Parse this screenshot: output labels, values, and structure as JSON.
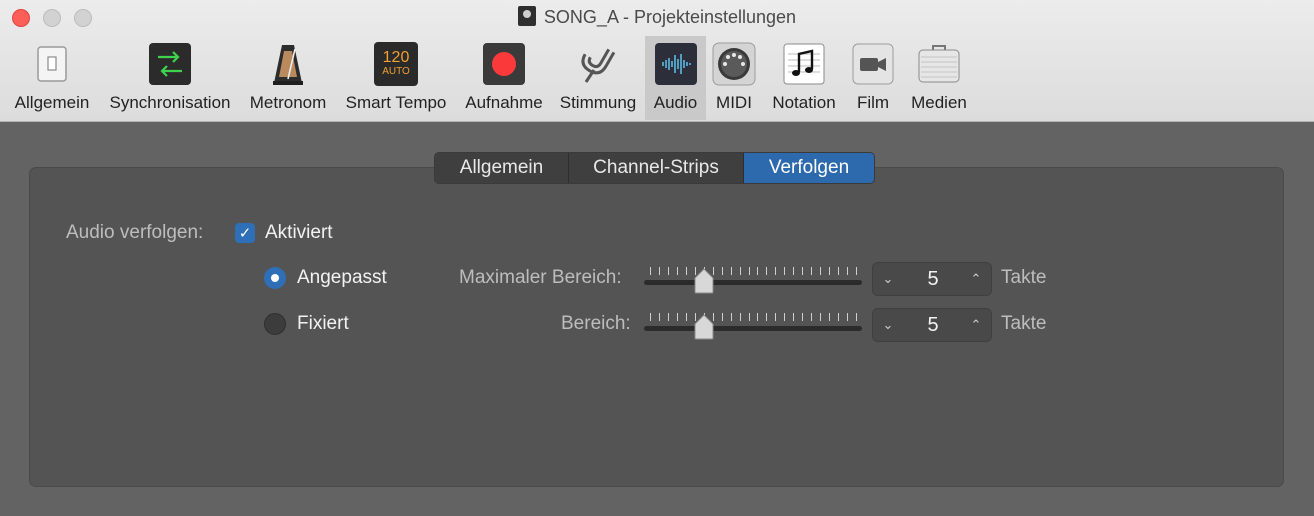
{
  "window": {
    "title": "SONG_A - Projekteinstellungen"
  },
  "toolbar": {
    "items": [
      {
        "label": "Allgemein",
        "icon": "switch-icon"
      },
      {
        "label": "Synchronisation",
        "icon": "sync-arrows-icon"
      },
      {
        "label": "Metronom",
        "icon": "metronome-icon"
      },
      {
        "label": "Smart Tempo",
        "icon": "smart-tempo-icon",
        "badge_top": "120",
        "badge_bottom": "AUTO"
      },
      {
        "label": "Aufnahme",
        "icon": "record-icon"
      },
      {
        "label": "Stimmung",
        "icon": "tuning-fork-icon"
      },
      {
        "label": "Audio",
        "icon": "waveform-icon",
        "active": true
      },
      {
        "label": "MIDI",
        "icon": "midi-connector-icon"
      },
      {
        "label": "Notation",
        "icon": "music-note-icon"
      },
      {
        "label": "Film",
        "icon": "video-camera-icon"
      },
      {
        "label": "Medien",
        "icon": "media-case-icon"
      }
    ]
  },
  "tabs": {
    "items": [
      "Allgemein",
      "Channel-Strips",
      "Verfolgen"
    ],
    "selected": "Verfolgen"
  },
  "form": {
    "audio_follow_label": "Audio verfolgen:",
    "enabled_label": "Aktiviert",
    "enabled_checked": true,
    "mode_adapted_label": "Angepasst",
    "mode_fixed_label": "Fixiert",
    "selected_mode": "Angepasst",
    "max_range_label": "Maximaler Bereich:",
    "max_range_value": "5",
    "range_label": "Bereich:",
    "range_value": "5",
    "unit_label": "Takte"
  },
  "colors": {
    "accent": "#2c69ad",
    "record": "#fa3a3a",
    "close": "#fc5f57"
  }
}
